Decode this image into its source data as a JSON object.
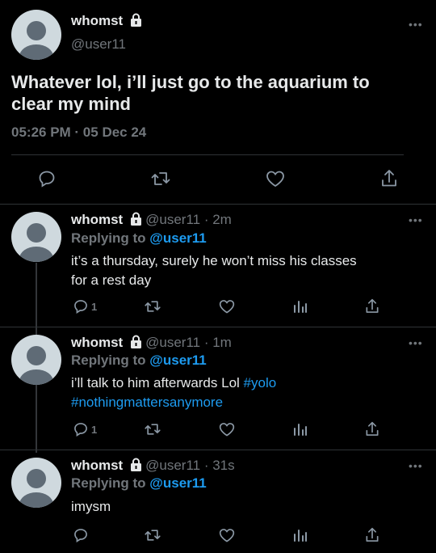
{
  "main_tweet": {
    "name": "whomst",
    "handle": "@user11",
    "text_line1": "Whatever lol, i’ll just go to the aquarium to",
    "text_line2": "clear my mind",
    "time": "05:26 PM · 05 Dec 24",
    "more": "•••"
  },
  "replies": [
    {
      "name": "whomst",
      "handle_time": "@user11 · 2m",
      "replying_prefix": "Replying to ",
      "replying_to": "@user11",
      "text_line1": "it’s a thursday, surely he won’t miss his classes",
      "text_line2": "for a rest day",
      "reply_count": "1",
      "more": "•••"
    },
    {
      "name": "whomst",
      "handle_time": "@user11 · 1m",
      "replying_prefix": "Replying to ",
      "replying_to": "@user11",
      "text_plain": "i’ll talk to him afterwards Lol ",
      "hashtag1": "#yolo",
      "hashtag2": "#nothingmattersanymore",
      "reply_count": "1",
      "more": "•••"
    },
    {
      "name": "whomst",
      "handle_time": "@user11 · 31s",
      "replying_prefix": "Replying to ",
      "replying_to": "@user11",
      "text_line1": "imysm",
      "reply_count": "",
      "more": "•••"
    }
  ],
  "icons": {
    "reply": "reply-icon",
    "retweet": "retweet-icon",
    "like": "heart-icon",
    "share": "share-icon",
    "analytics": "analytics-icon",
    "lock": "lock-icon"
  },
  "colors": {
    "background": "#000000",
    "text": "#e7e9ea",
    "muted": "#71767b",
    "accent": "#1d9bf0"
  }
}
